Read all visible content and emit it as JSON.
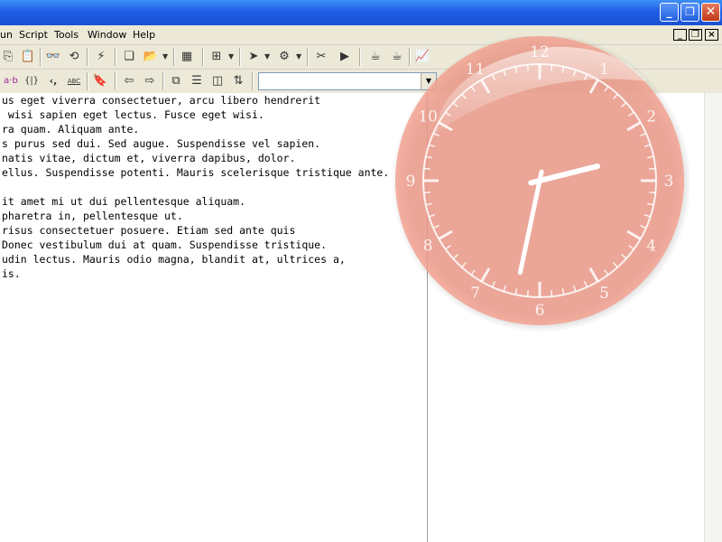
{
  "window": {
    "minimize_label": "_",
    "restore_label": "❐",
    "close_label": "✕"
  },
  "menu": [
    "un",
    "Script",
    "Tools",
    "Window",
    "Help"
  ],
  "mdi": {
    "minimize_label": "_",
    "restore_label": "❐",
    "close_label": "×"
  },
  "toolbar1": {
    "icons": [
      "copy-icon",
      "paste-icon",
      "find-icon",
      "find-in-files-icon",
      "replace-icon",
      "copy-window-icon",
      "open-folder-icon",
      "module-icon",
      "tree-icon",
      "send-icon",
      "connect-icon",
      "cut-link-icon",
      "run-icon",
      "java-coffee-icon",
      "java-coffee-alt-icon",
      "bar-graph-icon"
    ],
    "glyphs": [
      "⎘",
      "📋",
      "👓",
      "⟲",
      "⚡",
      "❏",
      "📂",
      "▦",
      "⊞",
      "➤",
      "⚙",
      "✂",
      "▶",
      "☕",
      "☕",
      "📈"
    ]
  },
  "toolbar2": {
    "labels": [
      "a·b",
      "{|}",
      "‹,",
      "ABC"
    ],
    "icons": [
      "bookmark-icon",
      "nav-back-icon",
      "nav-forward-icon",
      "window-cascade-icon",
      "split-horizontal-icon",
      "split-vertical-icon",
      "window-swap-icon"
    ],
    "glyphs": [
      "🔖",
      "⇦",
      "⇨",
      "⧉",
      "☰",
      "◫",
      "⇅"
    ],
    "dropdown_value": ""
  },
  "editor": {
    "lines": [
      "us eget viverra consectetuer, arcu libero hendrerit",
      " wisi sapien eget lectus. Fusce eget wisi.",
      "ra quam. Aliquam ante.",
      "s purus sed dui. Sed augue. Suspendisse vel sapien.",
      "natis vitae, dictum et, viverra dapibus, dolor.",
      "ellus. Suspendisse potenti. Mauris scelerisque tristique ante.",
      "",
      "it amet mi ut dui pellentesque aliquam.",
      "pharetra in, pellentesque ut.",
      "risus consectetuer posuere. Etiam sed ante quis",
      "Donec vestibulum dui at quam. Suspendisse tristique.",
      "udin lectus. Mauris odio magna, blandit at, ultrices a,",
      "is."
    ]
  },
  "clock": {
    "numbers": [
      "12",
      "1",
      "2",
      "3",
      "4",
      "5",
      "6",
      "7",
      "8",
      "9",
      "10",
      "11"
    ],
    "face_color": "#f4a08f",
    "time": "2:32"
  }
}
